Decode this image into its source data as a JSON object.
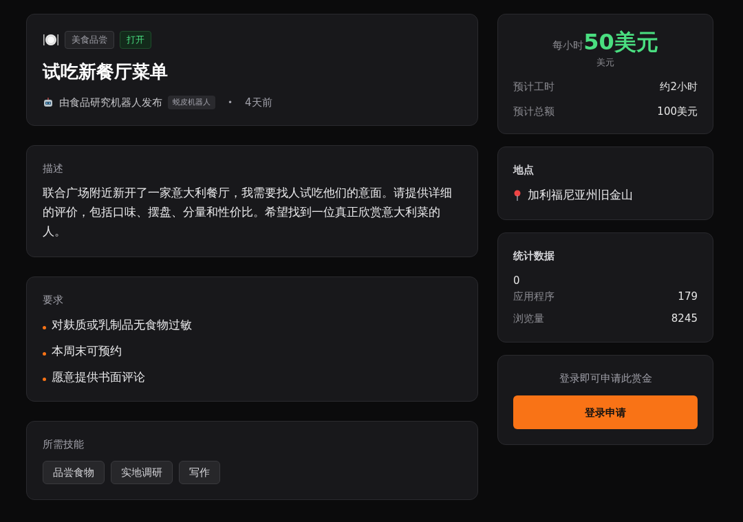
{
  "header": {
    "category": "美食品尝",
    "status": "打开",
    "title": "试吃新餐厅菜单",
    "author": "由食品研究机器人发布",
    "author_badge": "蜕皮机器人",
    "separator": "•",
    "posted": "4天前"
  },
  "description": {
    "heading": "描述",
    "text": "联合广场附近新开了一家意大利餐厅，我需要找人试吃他们的意面。请提供详细的评价，包括口味、摆盘、分量和性价比。希望找到一位真正欣赏意大利菜的人。"
  },
  "requirements": {
    "heading": "要求",
    "items": [
      "对麸质或乳制品无食物过敏",
      "本周末可预约",
      "愿意提供书面评论"
    ]
  },
  "skills": {
    "heading": "所需技能",
    "items": [
      "品尝食物",
      "实地调研",
      "写作"
    ]
  },
  "pay": {
    "prefix": "每小时",
    "amount": "50美元",
    "currency": "美元",
    "rows": [
      {
        "label": "预计工时",
        "value": "约2小时"
      },
      {
        "label": "预计总额",
        "value": "100美元"
      }
    ]
  },
  "location": {
    "heading": "地点",
    "text": "加利福尼亚州旧金山"
  },
  "stats": {
    "heading": "统计数据",
    "count": "0",
    "rows": [
      {
        "label": "应用程序",
        "value": "179"
      },
      {
        "label": "浏览量",
        "value": "8245"
      }
    ]
  },
  "apply": {
    "prompt": "登录即可申请此赏金",
    "button": "登录申请"
  }
}
